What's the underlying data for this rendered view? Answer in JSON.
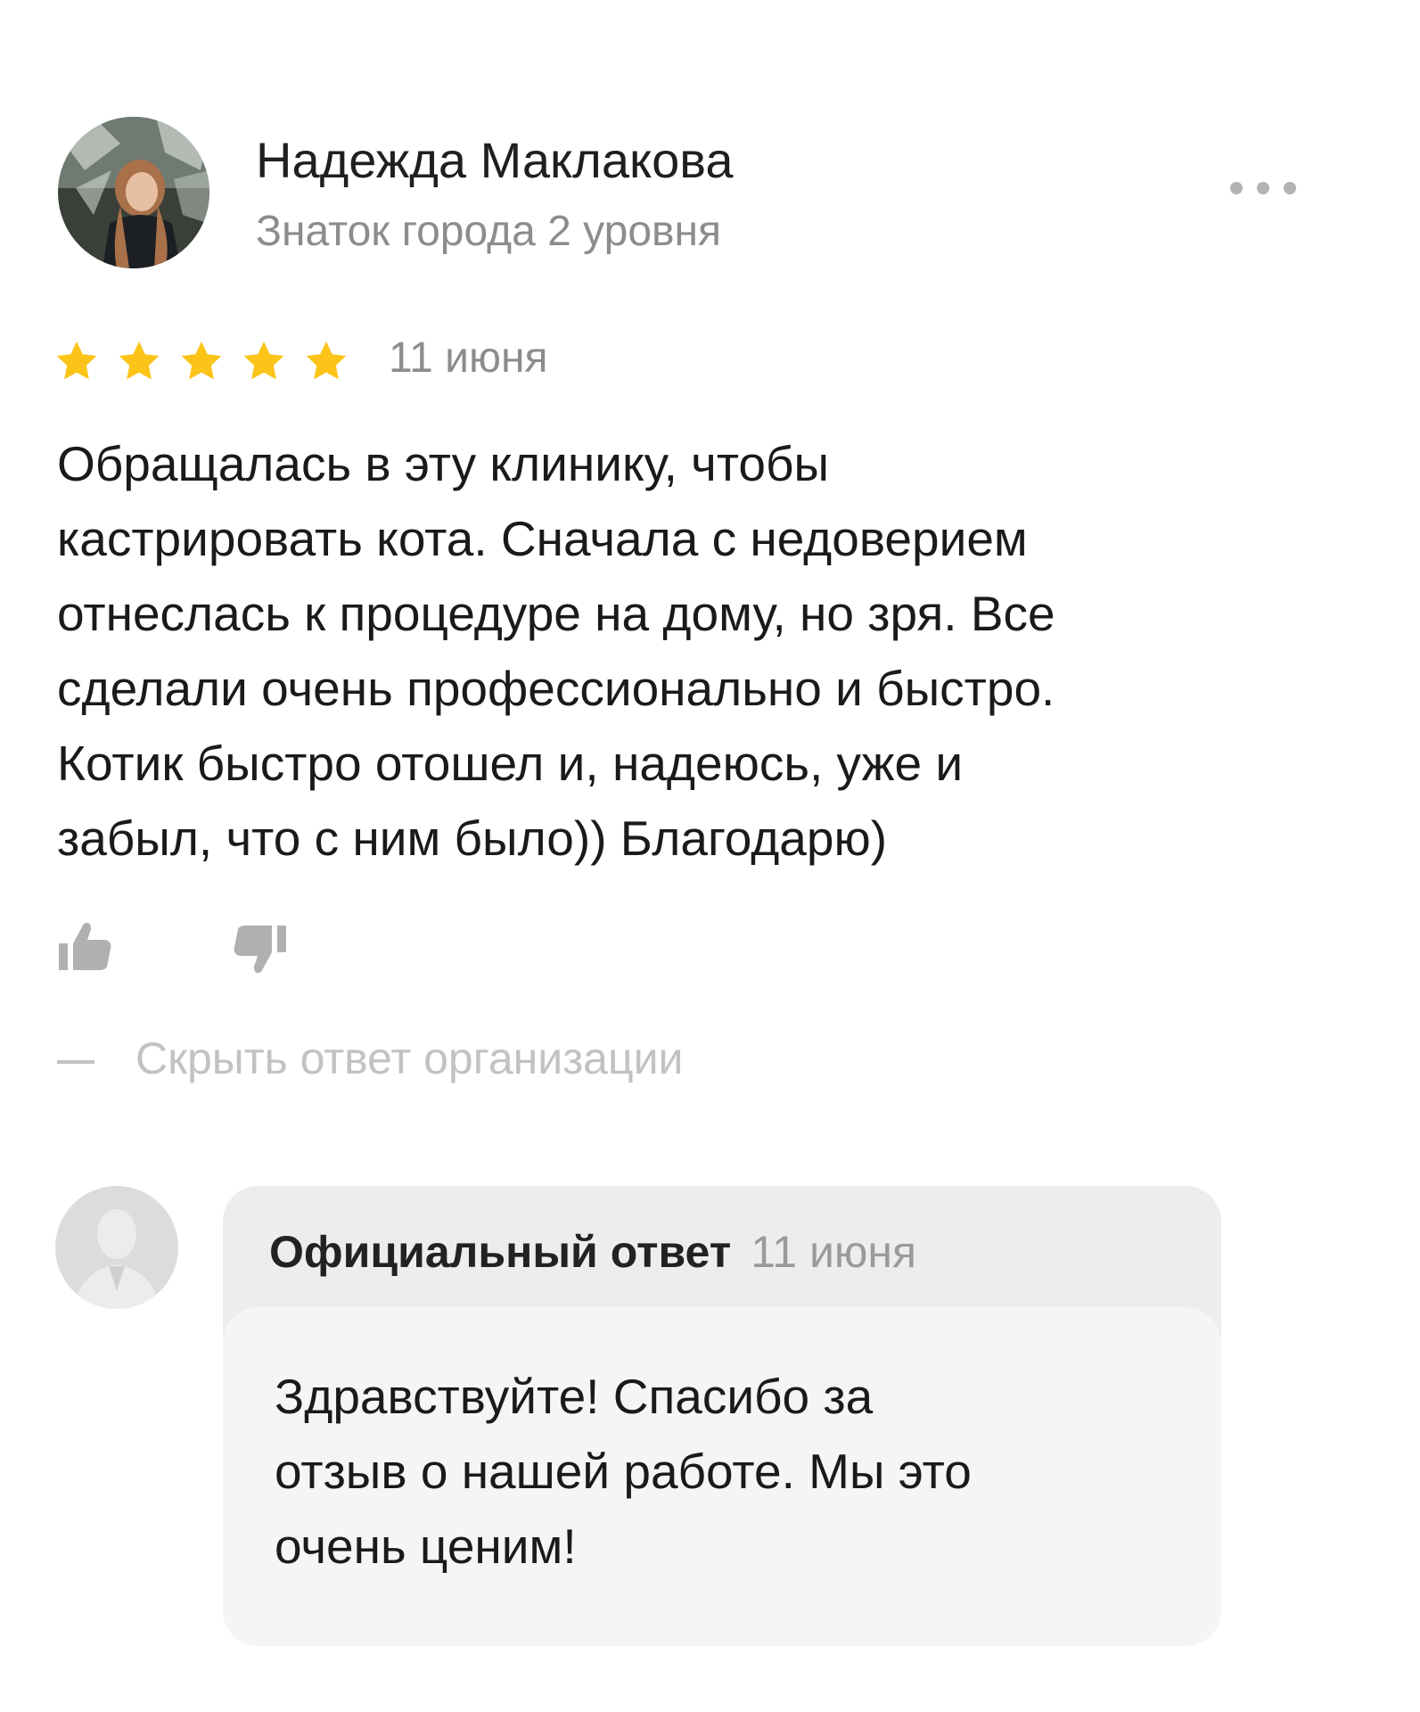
{
  "author": {
    "name": "Надежда Маклакова",
    "level": "Знаток города 2 уровня",
    "avatar_icon": "user-photo-avatar"
  },
  "menu": {
    "more_icon": "more-dots-icon"
  },
  "review": {
    "rating": 5,
    "rating_max": 5,
    "star_color": "#fcc419",
    "date": "11 июня",
    "text_lines": [
      "Обращалась в эту клинику, чтобы",
      "кастрировать кота. Сначала с недоверием",
      "отнеслась к процедуре на дому, но зря. Все",
      "сделали очень профессионально и быстро.",
      "Котик быстро отошел и, надеюсь, уже и",
      "забыл, что с ним было)) Благодарю)"
    ]
  },
  "reactions": {
    "like_icon": "thumbs-up-icon",
    "dislike_icon": "thumbs-down-icon"
  },
  "hide_response": {
    "label": "Скрыть ответ организации"
  },
  "official_response": {
    "avatar_icon": "organization-avatar-placeholder",
    "title": "Официальный ответ",
    "date": "11 июня",
    "text_lines": [
      "Здравствуйте! Спасибо за",
      "отзыв о нашей работе. Мы это",
      "очень ценим!"
    ]
  }
}
